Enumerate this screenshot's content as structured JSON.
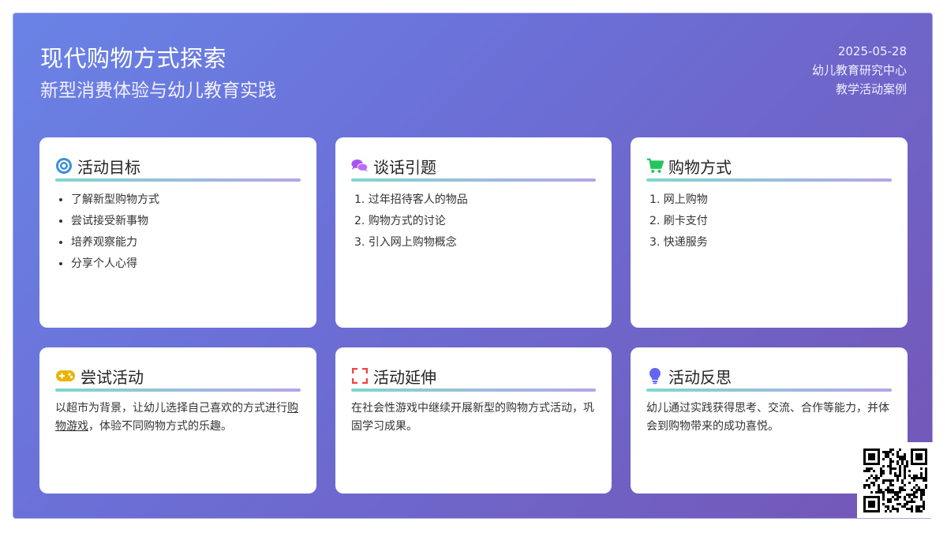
{
  "header": {
    "title": "现代购物方式探索",
    "subtitle": "新型消费体验与幼儿教育实践",
    "date": "2025-05-28",
    "org": "幼儿教育研究中心",
    "type": "教学活动案例"
  },
  "cards": {
    "goals": {
      "title": "活动目标",
      "icon": "target-icon",
      "items": [
        "了解新型购物方式",
        "尝试接受新事物",
        "培养观察能力",
        "分享个人心得"
      ]
    },
    "intro": {
      "title": "谈话引题",
      "icon": "chat-bubbles-icon",
      "items": [
        "1. 过年招待客人的物品",
        "2. 购物方式的讨论",
        "3. 引入网上购物概念"
      ]
    },
    "methods": {
      "title": "购物方式",
      "icon": "shopping-cart-icon",
      "items": [
        "1. 网上购物",
        "2. 刷卡支付",
        "3. 快递服务"
      ]
    },
    "trial": {
      "title": "尝试活动",
      "icon": "gamepad-icon",
      "text_before": "以超市为背景，让幼儿选择自己喜欢的方式进行",
      "text_link": "购物游戏",
      "text_after": "，体验不同购物方式的乐趣。"
    },
    "extension": {
      "title": "活动延伸",
      "icon": "expand-icon",
      "text": "在社会性游戏中继续开展新型的购物方式活动，巩固学习成果。"
    },
    "reflection": {
      "title": "活动反思",
      "icon": "lightbulb-icon",
      "text": "幼儿通过实践获得思考、交流、合作等能力，并体会到购物带来的成功喜悦。"
    }
  },
  "colors": {
    "background_start": "#6a83e6",
    "background_end": "#7456b6",
    "rule_start": "#7fd6cf",
    "rule_end": "#b4a6e6"
  }
}
